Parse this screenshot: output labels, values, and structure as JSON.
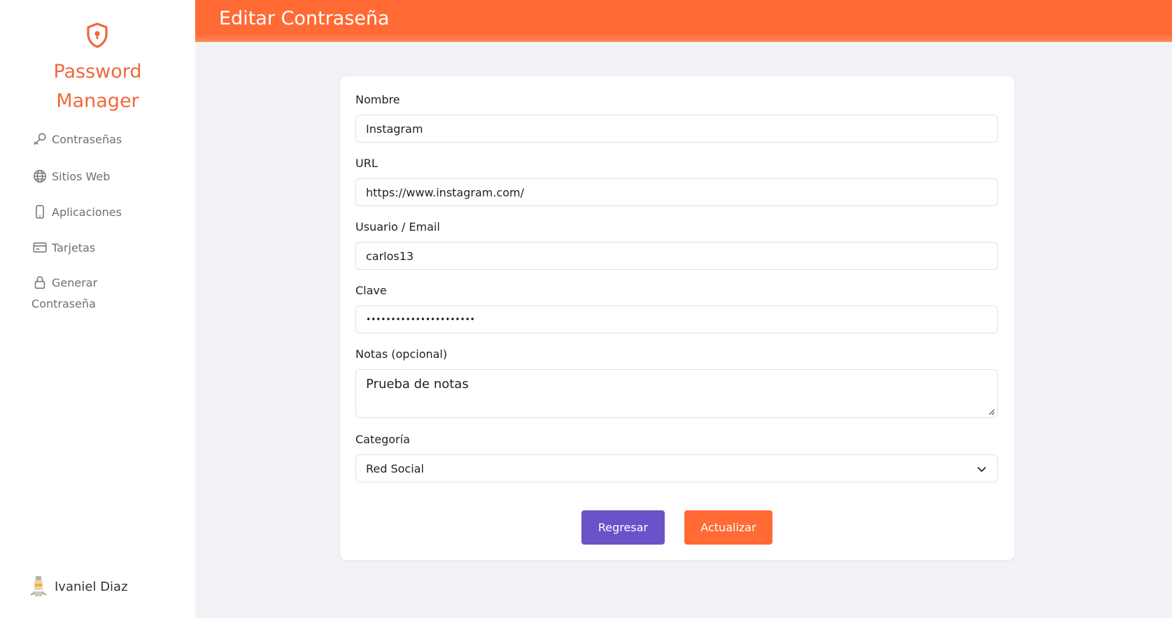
{
  "brand": {
    "title_line1": "Password",
    "title_line2": "Manager",
    "icon": "shield-lock-icon",
    "color": "#f0683a"
  },
  "sidebar": {
    "items": [
      {
        "label": "Contraseñas",
        "icon": "key-icon"
      },
      {
        "label": "Sitios Web",
        "icon": "globe-icon"
      },
      {
        "label": "Aplicaciones",
        "icon": "phone-icon"
      },
      {
        "label": "Tarjetas",
        "icon": "credit-card-icon"
      },
      {
        "label_line1": "Generar",
        "label_line2": "Contraseña",
        "icon": "lock-icon"
      }
    ]
  },
  "user": {
    "name": "Ivaniel Diaz",
    "icon": "avatar-icon"
  },
  "header": {
    "title": "Editar Contraseña",
    "color": "#ff6a35"
  },
  "form": {
    "nombre": {
      "label": "Nombre",
      "value": "Instagram"
    },
    "url": {
      "label": "URL",
      "value": "https://www.instagram.com/"
    },
    "usuario": {
      "label": "Usuario / Email",
      "value": "carlos13"
    },
    "clave": {
      "label": "Clave",
      "value": "••••••••••••••••••••••"
    },
    "notas": {
      "label": "Notas (opcional)",
      "value": "Prueba de notas"
    },
    "categoria": {
      "label": "Categoría",
      "value": "Red Social"
    }
  },
  "buttons": {
    "back": {
      "label": "Regresar",
      "color": "#6a52c8"
    },
    "update": {
      "label": "Actualizar",
      "color": "#ff6a35"
    }
  }
}
